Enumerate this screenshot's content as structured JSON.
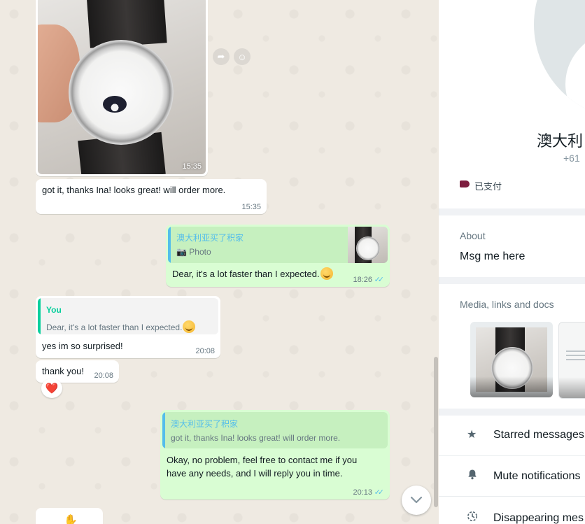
{
  "chat": {
    "photo_incoming_time": "15:35",
    "msg1": {
      "text": "got it, thanks Ina! looks great! will order more.",
      "time": "15:35"
    },
    "msg2": {
      "quote_author": "澳大利亚买了积家",
      "quote_type": "Photo",
      "text": "Dear, it's a lot faster than I expected.",
      "time": "18:26"
    },
    "msg3": {
      "quote_author": "You",
      "quote_text": "Dear, it's a lot faster than I expected.",
      "text": "yes im so surprised!",
      "time": "20:08"
    },
    "msg4": {
      "text": "thank you!",
      "time": "20:08",
      "reaction": "❤️"
    },
    "msg5": {
      "quote_author": "澳大利亚买了积家",
      "quote_text": "got it, thanks Ina! looks great! will order more.",
      "text_line1": "Okay, no problem, feel free to contact me if you",
      "text_line2": "have any needs, and I will reply you in time.",
      "time": "20:13"
    },
    "icons": {
      "forward": "forward-icon",
      "emoji": "emoji-icon",
      "scroll_down": "chevron-down-icon"
    }
  },
  "contact": {
    "name": "澳大利",
    "phone": "+61",
    "label": "已支付",
    "label_color": "#7d1d3f",
    "about_title": "About",
    "about_text": "Msg me here",
    "media_title": "Media, links and docs",
    "menu": {
      "starred": "Starred messages",
      "mute": "Mute notifications",
      "disappearing": "Disappearing mes"
    }
  },
  "colors": {
    "chat_bg": "#efeae2",
    "incoming_bubble": "#ffffff",
    "outgoing_bubble": "#d9fdd3",
    "quote_bar_you": "#06cf9c",
    "quote_bar_contact": "#53bdeb",
    "read_ticks": "#53bdeb"
  }
}
